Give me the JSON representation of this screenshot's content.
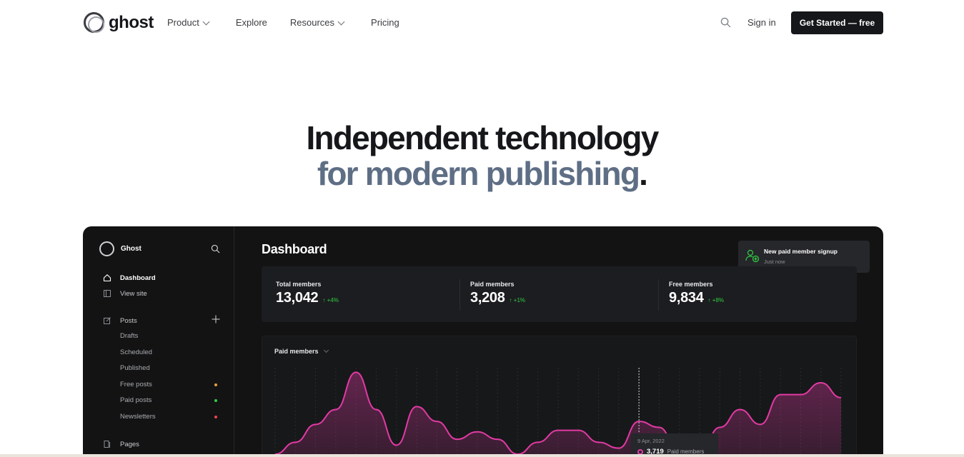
{
  "nav": {
    "brand": "ghost",
    "links": [
      {
        "label": "Product",
        "has_dropdown": true
      },
      {
        "label": "Explore",
        "has_dropdown": false
      },
      {
        "label": "Resources",
        "has_dropdown": true
      },
      {
        "label": "Pricing",
        "has_dropdown": false
      }
    ],
    "search_icon": "search-icon",
    "signin": "Sign in",
    "cta": "Get Started — free"
  },
  "hero": {
    "line1": "Independent technology",
    "line2": "for modern publishing",
    "dot": "."
  },
  "dashboard": {
    "brand": "Ghost",
    "sidebar": {
      "primary": [
        {
          "label": "Dashboard",
          "icon": "home-icon",
          "active": true
        },
        {
          "label": "View site",
          "icon": "layout-icon",
          "active": false
        }
      ],
      "posts": {
        "label": "Posts",
        "icon": "edit-icon"
      },
      "post_items": [
        {
          "label": "Drafts"
        },
        {
          "label": "Scheduled"
        },
        {
          "label": "Published"
        },
        {
          "label": "Free posts",
          "dot_color": "#e6a23c"
        },
        {
          "label": "Paid posts",
          "dot_color": "#30cf43"
        },
        {
          "label": "Newsletters",
          "dot_color": "#f0444e"
        }
      ],
      "pages": {
        "label": "Pages",
        "icon": "pages-icon"
      }
    },
    "title": "Dashboard",
    "toast": {
      "title": "New paid member signup",
      "subtitle": "Just now",
      "icon": "user-add-icon"
    },
    "stats": [
      {
        "label": "Total members",
        "value": "13,042",
        "delta": "+4%"
      },
      {
        "label": "Paid members",
        "value": "3,208",
        "delta": "+1%"
      },
      {
        "label": "Free members",
        "value": "9,834",
        "delta": "+8%"
      }
    ],
    "chart_label": "Paid members",
    "tooltip": {
      "date": "9 Apr, 2022",
      "value": "3,719",
      "label": "Paid members"
    },
    "colors": {
      "accent": "#e23aa4",
      "positive": "#30cf43"
    }
  },
  "chart_data": {
    "type": "area",
    "title": "",
    "series": [
      {
        "name": "Paid members",
        "values": [
          0,
          8,
          20,
          30,
          55,
          30,
          6,
          32,
          22,
          10,
          15,
          10,
          0,
          8,
          16,
          16,
          8,
          4,
          22,
          18,
          0,
          0,
          18,
          30,
          20,
          40,
          40,
          48,
          38
        ]
      }
    ],
    "ylim": [
      0,
      60
    ],
    "grid": true
  }
}
